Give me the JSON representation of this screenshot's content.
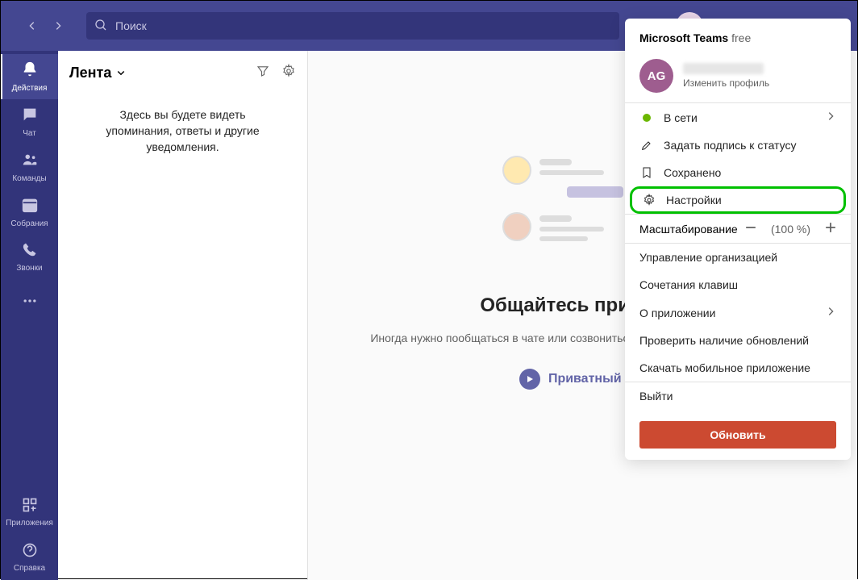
{
  "search": {
    "placeholder": "Поиск"
  },
  "sidebar": {
    "items": [
      {
        "label": "Действия"
      },
      {
        "label": "Чат"
      },
      {
        "label": "Команды"
      },
      {
        "label": "Собрания"
      },
      {
        "label": "Звонки"
      }
    ],
    "apps": "Приложения",
    "help": "Справка"
  },
  "feed": {
    "title": "Лента",
    "empty": "Здесь вы будете видеть упоминания, ответы и другие уведомления."
  },
  "main": {
    "title": "Общайтесь приватно",
    "subtitle": "Иногда нужно пообщаться в чате или созвониться по видеозвонок один на один.",
    "button": "Приватный чат"
  },
  "profile_menu": {
    "brand": "Microsoft Teams",
    "tier": "free",
    "initials": "AG",
    "edit_profile": "Изменить профиль",
    "status": {
      "label": "В сети"
    },
    "set_status_message": "Задать подпись к статусу",
    "saved": "Сохранено",
    "settings": "Настройки",
    "zoom": {
      "label": "Масштабирование",
      "value": "(100 %)"
    },
    "manage_org": "Управление организацией",
    "shortcuts": "Сочетания клавиш",
    "about": "О приложении",
    "check_updates": "Проверить наличие обновлений",
    "download_mobile": "Скачать мобильное приложение",
    "sign_out": "Выйти",
    "update": "Обновить"
  }
}
